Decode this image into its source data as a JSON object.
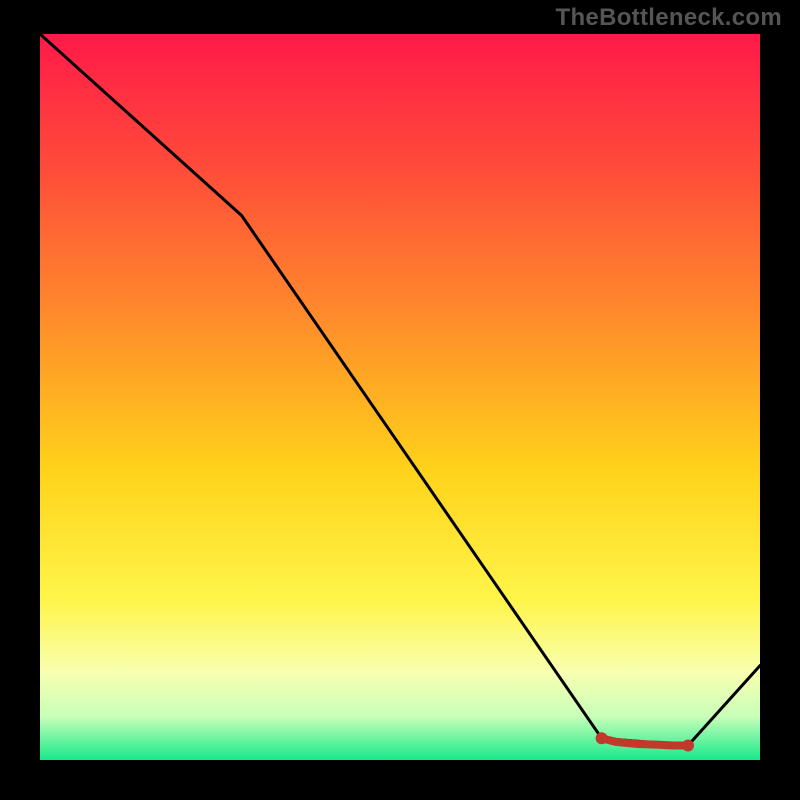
{
  "watermark": "TheBottleneck.com",
  "chart_data": {
    "type": "line",
    "title": "",
    "xlabel": "",
    "ylabel": "",
    "xlim": [
      0,
      100
    ],
    "ylim": [
      0,
      100
    ],
    "grid": false,
    "series": [
      {
        "name": "curve",
        "x": [
          0,
          28,
          78,
          90,
          100
        ],
        "values": [
          100,
          75,
          3,
          2,
          13
        ]
      }
    ],
    "markers": {
      "name": "highlight-cluster",
      "x": [
        78,
        80,
        83,
        86,
        88,
        90
      ],
      "values": [
        3,
        2.5,
        2.2,
        2.1,
        2,
        2
      ]
    },
    "gradient_stops": [
      {
        "offset": 0.0,
        "color": "#ff1a49"
      },
      {
        "offset": 0.18,
        "color": "#ff4a3a"
      },
      {
        "offset": 0.4,
        "color": "#ff8f2a"
      },
      {
        "offset": 0.6,
        "color": "#ffd21a"
      },
      {
        "offset": 0.78,
        "color": "#fff54a"
      },
      {
        "offset": 0.88,
        "color": "#f8ffb0"
      },
      {
        "offset": 0.94,
        "color": "#c8ffb8"
      },
      {
        "offset": 1.0,
        "color": "#17e98b"
      }
    ]
  }
}
